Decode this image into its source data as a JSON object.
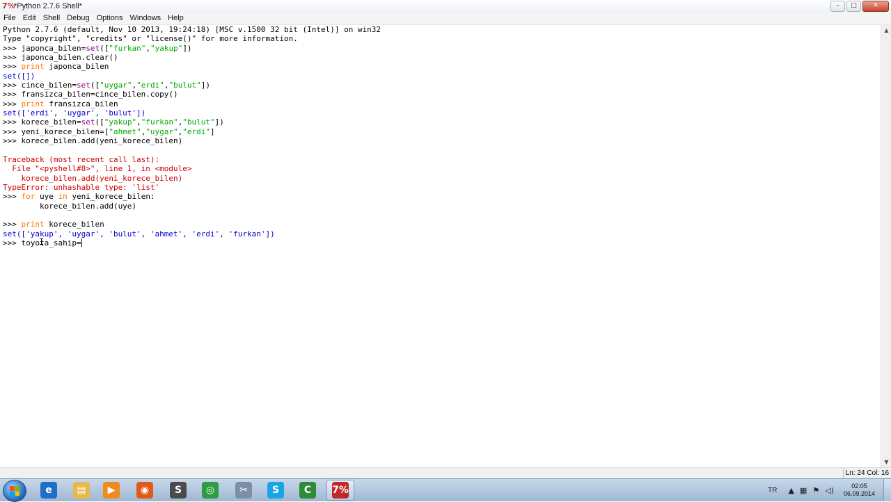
{
  "window": {
    "app_icon": "7%",
    "title": "*Python 2.7.6 Shell*",
    "buttons": {
      "minimize": "–",
      "maximize": "□",
      "close": "✕"
    }
  },
  "menu": [
    "File",
    "Edit",
    "Shell",
    "Debug",
    "Options",
    "Windows",
    "Help"
  ],
  "shell_lines": [
    [
      {
        "t": "Python 2.7.6 (default, Nov 10 2013, 19:24:18) [MSC v.1500 32 bit (Intel)] on win32",
        "c": ""
      }
    ],
    [
      {
        "t": "Type \"copyright\", \"credits\" or \"license()\" for more information.",
        "c": ""
      }
    ],
    [
      {
        "t": ">>> japonca_bilen=",
        "c": ""
      },
      {
        "t": "set",
        "c": "bi"
      },
      {
        "t": "([",
        "c": ""
      },
      {
        "t": "\"furkan\"",
        "c": "str"
      },
      {
        "t": ",",
        "c": ""
      },
      {
        "t": "\"yakup\"",
        "c": "str"
      },
      {
        "t": "])",
        "c": ""
      }
    ],
    [
      {
        "t": ">>> japonca_bilen.clear()",
        "c": ""
      }
    ],
    [
      {
        "t": ">>> ",
        "c": ""
      },
      {
        "t": "print",
        "c": "kw"
      },
      {
        "t": " japonca_bilen",
        "c": ""
      }
    ],
    [
      {
        "t": "set([])",
        "c": "out"
      }
    ],
    [
      {
        "t": ">>> cince_bilen=",
        "c": ""
      },
      {
        "t": "set",
        "c": "bi"
      },
      {
        "t": "([",
        "c": ""
      },
      {
        "t": "\"uygar\"",
        "c": "str"
      },
      {
        "t": ",",
        "c": ""
      },
      {
        "t": "\"erdi\"",
        "c": "str"
      },
      {
        "t": ",",
        "c": ""
      },
      {
        "t": "\"bulut\"",
        "c": "str"
      },
      {
        "t": "])",
        "c": ""
      }
    ],
    [
      {
        "t": ">>> fransizca_bilen=cince_bilen.copy()",
        "c": ""
      }
    ],
    [
      {
        "t": ">>> ",
        "c": ""
      },
      {
        "t": "print",
        "c": "kw"
      },
      {
        "t": " fransizca_bilen",
        "c": ""
      }
    ],
    [
      {
        "t": "set(['erdi', 'uygar', 'bulut'])",
        "c": "out"
      }
    ],
    [
      {
        "t": ">>> korece_bilen=",
        "c": ""
      },
      {
        "t": "set",
        "c": "bi"
      },
      {
        "t": "([",
        "c": ""
      },
      {
        "t": "\"yakup\"",
        "c": "str"
      },
      {
        "t": ",",
        "c": ""
      },
      {
        "t": "\"furkan\"",
        "c": "str"
      },
      {
        "t": ",",
        "c": ""
      },
      {
        "t": "\"bulut\"",
        "c": "str"
      },
      {
        "t": "])",
        "c": ""
      }
    ],
    [
      {
        "t": ">>> yeni_korece_bilen=[",
        "c": ""
      },
      {
        "t": "\"ahmet\"",
        "c": "str"
      },
      {
        "t": ",",
        "c": ""
      },
      {
        "t": "\"uygar\"",
        "c": "str"
      },
      {
        "t": ",",
        "c": ""
      },
      {
        "t": "\"erdi\"",
        "c": "str"
      },
      {
        "t": "]",
        "c": ""
      }
    ],
    [
      {
        "t": ">>> korece_bilen.add(yeni_korece_bilen)",
        "c": ""
      }
    ],
    [
      {
        "t": "",
        "c": ""
      }
    ],
    [
      {
        "t": "Traceback (most recent call last):",
        "c": "err"
      }
    ],
    [
      {
        "t": "  File \"<pyshell#8>\", line 1, in <module>",
        "c": "err"
      }
    ],
    [
      {
        "t": "    korece_bilen.add(yeni_korece_bilen)",
        "c": "err"
      }
    ],
    [
      {
        "t": "TypeError: unhashable type: 'list'",
        "c": "err"
      }
    ],
    [
      {
        "t": ">>> ",
        "c": ""
      },
      {
        "t": "for",
        "c": "kw"
      },
      {
        "t": " uye ",
        "c": ""
      },
      {
        "t": "in",
        "c": "kw"
      },
      {
        "t": " yeni_korece_bilen:",
        "c": ""
      }
    ],
    [
      {
        "t": "        korece_bilen.add(uye)",
        "c": ""
      }
    ],
    [
      {
        "t": "",
        "c": ""
      }
    ],
    [
      {
        "t": ">>> ",
        "c": ""
      },
      {
        "t": "print",
        "c": "kw"
      },
      {
        "t": " korece_bilen",
        "c": ""
      }
    ],
    [
      {
        "t": "set(['yakup', 'uygar', 'bulut', 'ahmet', 'erdi', 'furkan'])",
        "c": "out"
      }
    ],
    [
      {
        "t": ">>> toyota_sahip=",
        "c": ""
      }
    ]
  ],
  "status": {
    "position": "Ln: 24 Col: 16"
  },
  "taskbar": {
    "apps": [
      {
        "name": "ie",
        "glyph": "e",
        "color": "#1f6fc8"
      },
      {
        "name": "explorer",
        "glyph": "▤",
        "color": "#e8b84a"
      },
      {
        "name": "media-player",
        "glyph": "▶",
        "color": "#f08a1c"
      },
      {
        "name": "firefox",
        "glyph": "◉",
        "color": "#e0591b"
      },
      {
        "name": "sublime",
        "glyph": "S",
        "color": "#4b4b4b"
      },
      {
        "name": "chrome",
        "glyph": "◎",
        "color": "#2f9b45"
      },
      {
        "name": "snipping",
        "glyph": "✂",
        "color": "#7d8fa6"
      },
      {
        "name": "skype",
        "glyph": "S",
        "color": "#1aa4e8"
      },
      {
        "name": "camtasia",
        "glyph": "C",
        "color": "#2e8b3a"
      },
      {
        "name": "python-idle",
        "glyph": "7%",
        "color": "#c0282a"
      }
    ],
    "language": "TR",
    "clock_time": "02:05",
    "clock_date": "06.09.2014"
  }
}
